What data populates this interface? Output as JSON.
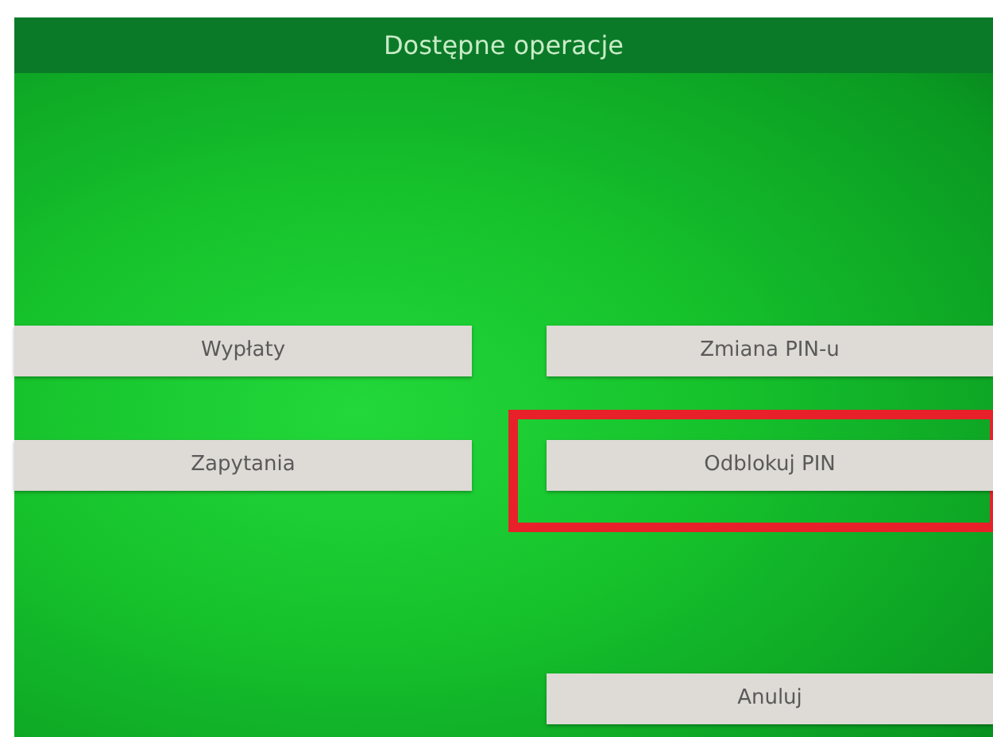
{
  "header": {
    "title": "Dostępne operacje"
  },
  "rows": [
    {
      "left": {
        "label": "Wypłaty",
        "highlighted": false
      },
      "right": {
        "label": "Zmiana PIN-u",
        "highlighted": false
      }
    },
    {
      "left": {
        "label": "Zapytania",
        "highlighted": false
      },
      "right": {
        "label": "Odblokuj PIN",
        "highlighted": true
      }
    },
    {
      "right": {
        "label": "Anuluj",
        "highlighted": false
      }
    }
  ]
}
